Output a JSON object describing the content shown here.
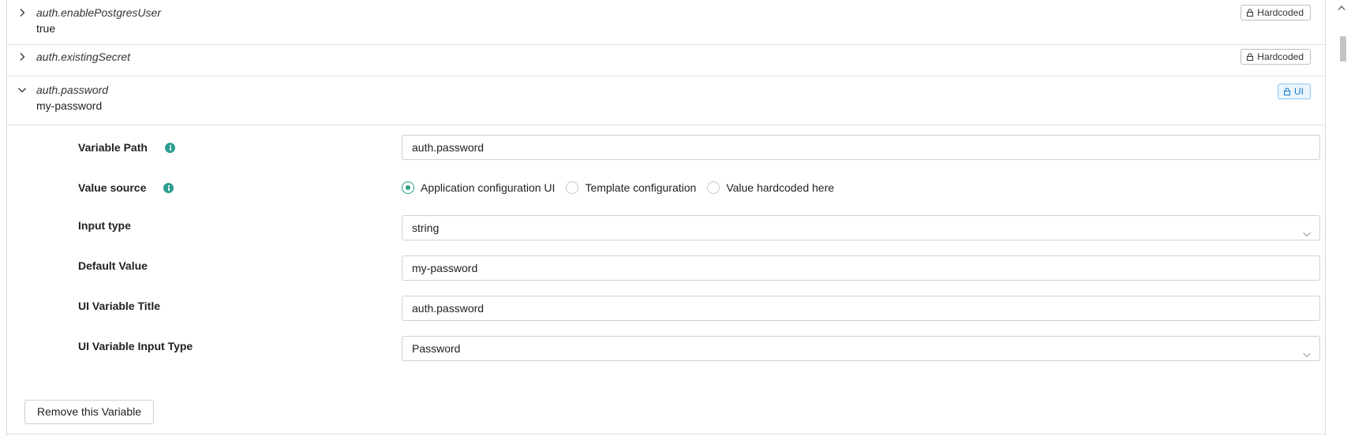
{
  "rows": [
    {
      "title": "auth.enablePostgresUser",
      "value": "true",
      "badge": "Hardcoded",
      "expanded": false
    },
    {
      "title": "auth.existingSecret",
      "value": "",
      "badge": "Hardcoded",
      "expanded": false
    },
    {
      "title": "auth.password",
      "value": "my-password",
      "badge": "UI",
      "expanded": true
    }
  ],
  "details": {
    "variable_path": {
      "label": "Variable Path",
      "value": "auth.password"
    },
    "value_source": {
      "label": "Value source",
      "options": [
        "Application configuration UI",
        "Template configuration",
        "Value hardcoded here"
      ],
      "selected": "Application configuration UI"
    },
    "input_type": {
      "label": "Input type",
      "value": "string"
    },
    "default_value": {
      "label": "Default Value",
      "value": "my-password"
    },
    "ui_variable_title": {
      "label": "UI Variable Title",
      "value": "auth.password"
    },
    "ui_variable_input_type": {
      "label": "UI Variable Input Type",
      "value": "Password"
    },
    "remove_button": "Remove this Variable"
  },
  "colors": {
    "accent": "#2a9d8f",
    "ui_badge": "#1677c8",
    "border": "#d0d0d0"
  }
}
